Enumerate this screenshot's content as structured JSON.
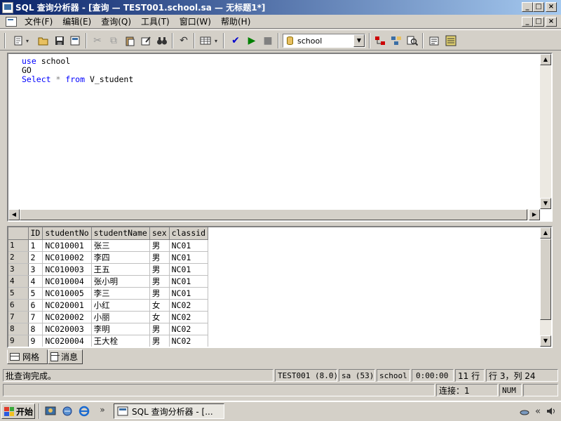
{
  "titlebar": {
    "title": "SQL 查询分析器 - [查询 — TEST001.school.sa — 无标题1*]",
    "minimize": "_",
    "restore": "□",
    "close": "×"
  },
  "menubar": {
    "items": [
      "文件(F)",
      "编辑(E)",
      "查询(Q)",
      "工具(T)",
      "窗口(W)",
      "帮助(H)"
    ]
  },
  "toolbar": {
    "database": "school"
  },
  "editor": {
    "lines": [
      {
        "kw": "use",
        "rest": " school"
      },
      {
        "kw": "",
        "rest": "GO"
      },
      {
        "kw": "Select",
        "op": " * ",
        "kw2": "from",
        "rest": " V_student"
      }
    ]
  },
  "results": {
    "columns": [
      "ID",
      "studentNo",
      "studentName",
      "sex",
      "classid"
    ],
    "rows": [
      {
        "n": "1",
        "ID": "1",
        "studentNo": "NC010001",
        "studentName": "张三",
        "sex": "男",
        "classid": "NC01"
      },
      {
        "n": "2",
        "ID": "2",
        "studentNo": "NC010002",
        "studentName": "李四",
        "sex": "男",
        "classid": "NC01"
      },
      {
        "n": "3",
        "ID": "3",
        "studentNo": "NC010003",
        "studentName": "王五",
        "sex": "男",
        "classid": "NC01"
      },
      {
        "n": "4",
        "ID": "4",
        "studentNo": "NC010004",
        "studentName": "张小明",
        "sex": "男",
        "classid": "NC01"
      },
      {
        "n": "5",
        "ID": "5",
        "studentNo": "NC010005",
        "studentName": "李三",
        "sex": "男",
        "classid": "NC01"
      },
      {
        "n": "6",
        "ID": "6",
        "studentNo": "NC020001",
        "studentName": "小红",
        "sex": "女",
        "classid": "NC02"
      },
      {
        "n": "7",
        "ID": "7",
        "studentNo": "NC020002",
        "studentName": "小丽",
        "sex": "女",
        "classid": "NC02"
      },
      {
        "n": "8",
        "ID": "8",
        "studentNo": "NC020003",
        "studentName": "李明",
        "sex": "男",
        "classid": "NC02"
      },
      {
        "n": "9",
        "ID": "9",
        "studentNo": "NC020004",
        "studentName": "王大栓",
        "sex": "男",
        "classid": "NC02"
      }
    ]
  },
  "tabs": {
    "grid": "网格",
    "messages": "消息"
  },
  "status": {
    "message": "批查询完成。",
    "server": "TEST001 (8.0)",
    "user": "sa (53)",
    "db": "school",
    "elapsed": "0:00:00",
    "rows": "11 行",
    "position": "行 3，列 24",
    "connections": "连接：1",
    "num": "NUM"
  },
  "taskbar": {
    "start": "开始",
    "chevron": "»",
    "task": "SQL 查询分析器 - [...",
    "tray_chevron": "«"
  },
  "colors": {
    "keyword": "#0000ff",
    "operator": "#808080",
    "title_start": "#0a246a",
    "title_end": "#a6caf0"
  }
}
